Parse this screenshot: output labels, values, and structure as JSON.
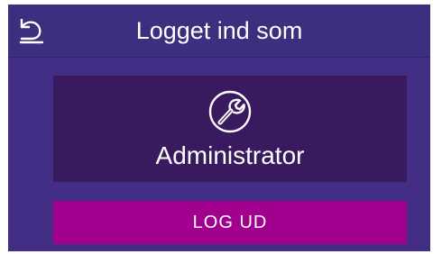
{
  "header": {
    "title": "Logget ind som",
    "back_icon": "back-arrow-icon"
  },
  "user_card": {
    "role": "Administrator",
    "role_icon": "wrench-icon"
  },
  "actions": {
    "logout_label": "LOG UD"
  },
  "colors": {
    "background": "#432e85",
    "header": "#3b2f80",
    "card": "#3a1a5f",
    "logout_button": "#a2008f",
    "text": "#ffffff"
  }
}
